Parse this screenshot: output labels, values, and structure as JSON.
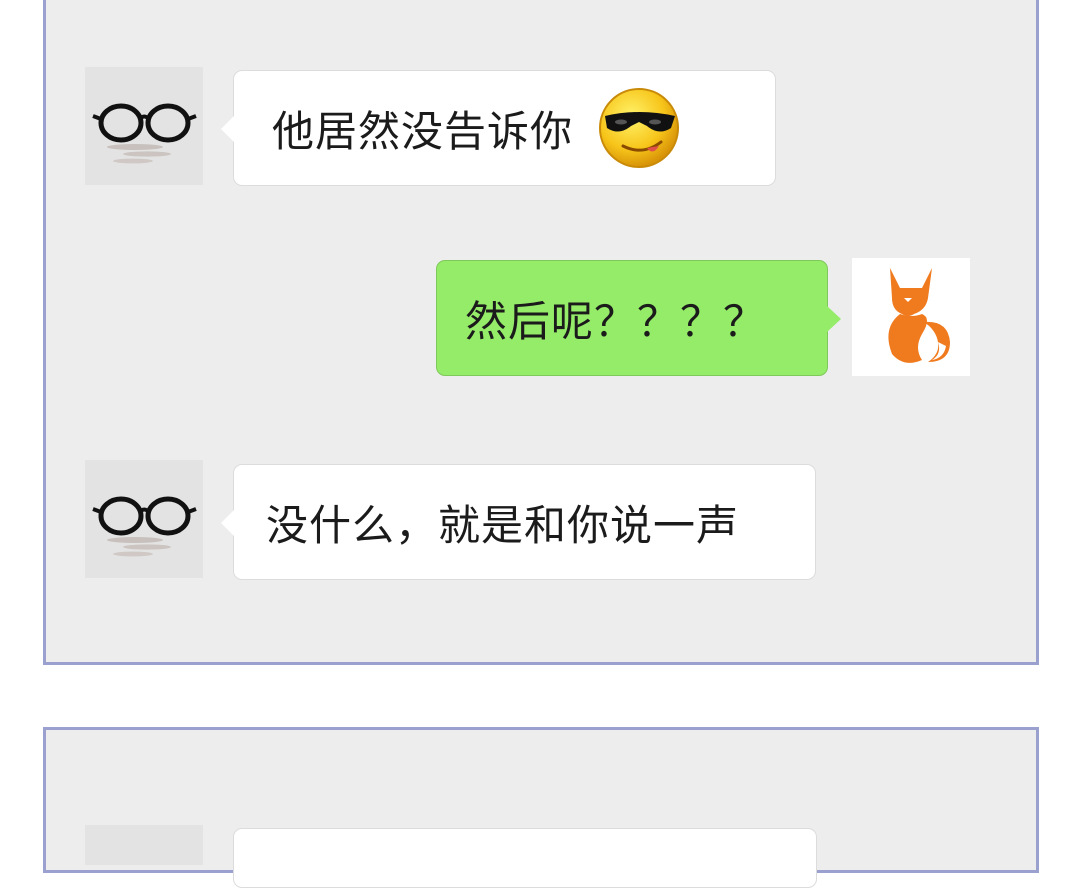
{
  "chat": {
    "messages": [
      {
        "side": "incoming",
        "avatar": "glasses-avatar",
        "text": "他居然没告诉你",
        "emoji": "sunglasses-smiley-emoji"
      },
      {
        "side": "outgoing",
        "avatar": "fox-avatar",
        "text": "然后呢？？？？"
      },
      {
        "side": "incoming",
        "avatar": "glasses-avatar",
        "text": "没什么，就是和你说一声"
      }
    ]
  },
  "colors": {
    "panel_bg": "#ededed",
    "panel_border": "#9aa1cf",
    "incoming_bubble": "#ffffff",
    "outgoing_bubble": "#95ec69",
    "text": "#1b1b1b",
    "fox": "#f07a1e"
  }
}
